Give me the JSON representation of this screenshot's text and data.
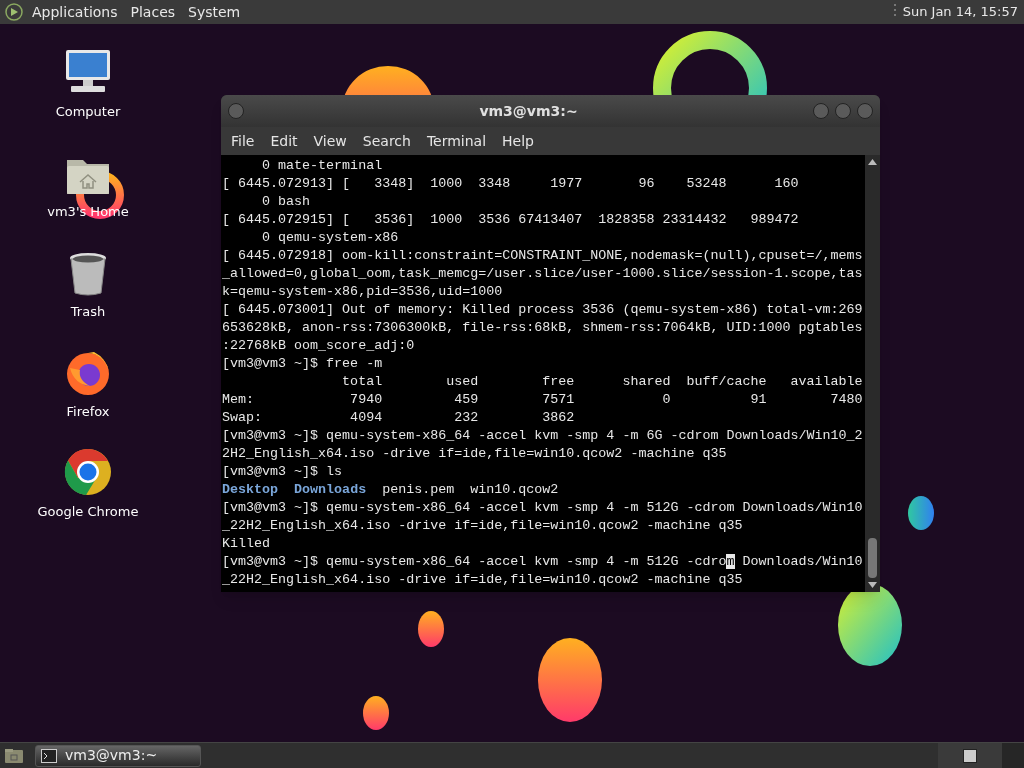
{
  "top_panel": {
    "menus": [
      "Applications",
      "Places",
      "System"
    ],
    "clock": "Sun Jan 14, 15:57"
  },
  "desktop_icons": [
    {
      "label": "Computer",
      "kind": "computer"
    },
    {
      "label": "vm3's Home",
      "kind": "home"
    },
    {
      "label": "Trash",
      "kind": "trash"
    },
    {
      "label": "Firefox",
      "kind": "firefox"
    },
    {
      "label": "Google Chrome",
      "kind": "chrome"
    }
  ],
  "window": {
    "title": "vm3@vm3:~",
    "menu": [
      "File",
      "Edit",
      "View",
      "Search",
      "Terminal",
      "Help"
    ],
    "lines": [
      {
        "text": "     0 mate-terminal"
      },
      {
        "text": "[ 6445.072913] [   3348]  1000  3348     1977       96    53248      160"
      },
      {
        "text": "     0 bash"
      },
      {
        "text": "[ 6445.072915] [   3536]  1000  3536 67413407  1828358 23314432   989472"
      },
      {
        "text": "     0 qemu-system-x86"
      },
      {
        "text": "[ 6445.072918] oom-kill:constraint=CONSTRAINT_NONE,nodemask=(null),cpuset=/,mems"
      },
      {
        "text": "_allowed=0,global_oom,task_memcg=/user.slice/user-1000.slice/session-1.scope,tas"
      },
      {
        "text": "k=qemu-system-x86,pid=3536,uid=1000"
      },
      {
        "text": "[ 6445.073001] Out of memory: Killed process 3536 (qemu-system-x86) total-vm:269"
      },
      {
        "text": "653628kB, anon-rss:7306300kB, file-rss:68kB, shmem-rss:7064kB, UID:1000 pgtables"
      },
      {
        "text": ":22768kB oom_score_adj:0"
      },
      {
        "text": "[vm3@vm3 ~]$ free -m"
      },
      {
        "text": "               total        used        free      shared  buff/cache   available"
      },
      {
        "text": "Mem:            7940         459        7571           0          91        7480"
      },
      {
        "text": "Swap:           4094         232        3862"
      },
      {
        "text": "[vm3@vm3 ~]$ qemu-system-x86_64 -accel kvm -smp 4 -m 6G -cdrom Downloads/Win10_2"
      },
      {
        "text": "2H2_English_x64.iso -drive if=ide,file=win10.qcow2 -machine q35"
      },
      {
        "text": "[vm3@vm3 ~]$ ls"
      },
      {
        "segments": [
          {
            "text": "Desktop",
            "kind": "dir"
          },
          {
            "text": "  Downloads",
            "kind": "dir"
          },
          {
            "text": "  penis.pem  win10.qcow2",
            "kind": "plain"
          }
        ]
      },
      {
        "text": "[vm3@vm3 ~]$ qemu-system-x86_64 -accel kvm -smp 4 -m 512G -cdrom Downloads/Win10"
      },
      {
        "text": "_22H2_English_x64.iso -drive if=ide,file=win10.qcow2 -machine q35"
      },
      {
        "text": "Killed"
      },
      {
        "segments": [
          {
            "text": "[vm3@vm3 ~]$ qemu-system-x86_64 -accel kvm -smp 4 -m 512G -cdro",
            "kind": "plain"
          },
          {
            "text": "m",
            "kind": "cursor"
          },
          {
            "text": " Downloads/Win10",
            "kind": "plain"
          }
        ]
      },
      {
        "text": "_22H2_English_x64.iso -drive if=ide,file=win10.qcow2 -machine q35"
      }
    ]
  },
  "taskbar": {
    "tasks": [
      {
        "label": "vm3@vm3:~",
        "selected": true
      }
    ]
  }
}
